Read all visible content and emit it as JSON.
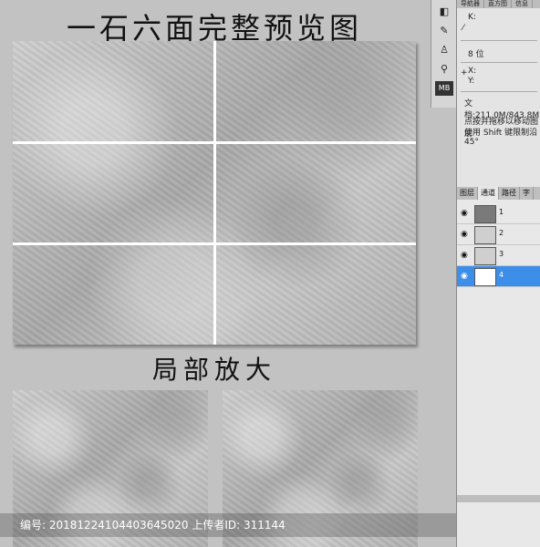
{
  "top_title": "一石六面完整预览图",
  "mid_title": "局部放大",
  "watermark_text": "编号: 20181224104403645020 上传者ID: 311144",
  "toolstrip": {
    "icons": [
      "channel-mixer-icon",
      "brush-icon",
      "clone-stamp-icon",
      "history-brush-icon",
      "mb-icon"
    ],
    "mb_label": "MB"
  },
  "info_panel": {
    "tabs": [
      "导航器",
      "直方图",
      "信息"
    ],
    "k_label": "K:",
    "bits": "8 位",
    "x_label": "X:",
    "y_label": "Y:",
    "doc_size": "文档:211.0M/843.8M",
    "hint_line1": "点按并拖移以移动图层",
    "hint_line2": "使用 Shift 键限制沿 45°"
  },
  "layers_panel": {
    "tabs": [
      "图层",
      "通道",
      "路径",
      "字"
    ],
    "channels": [
      {
        "label": "1"
      },
      {
        "label": "2"
      },
      {
        "label": "3"
      },
      {
        "label": "4"
      }
    ]
  }
}
